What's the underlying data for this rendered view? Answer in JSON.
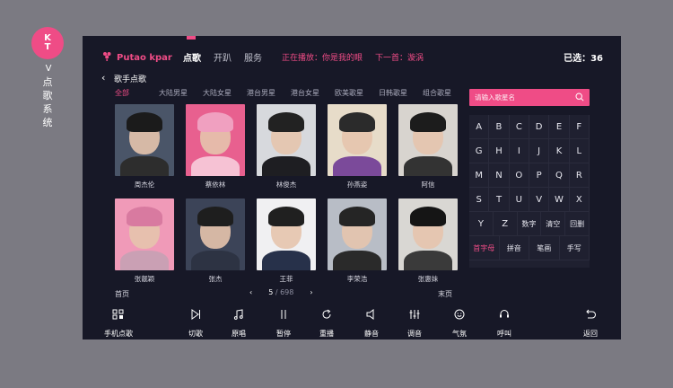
{
  "side": {
    "badge_k": "K",
    "badge_t": "T",
    "v": "V",
    "chars": [
      "点",
      "歌",
      "系",
      "统"
    ]
  },
  "header": {
    "logo_text": "Putao kpar",
    "nav": [
      "点歌",
      "开趴",
      "服务"
    ],
    "now_playing": "正在播放：你是我的眼",
    "next_up": "下一首：漩涡",
    "selected": "已选：36"
  },
  "page": {
    "title": "歌手点歌"
  },
  "categories": [
    "全部",
    "大陆男星",
    "大陆女星",
    "港台男星",
    "港台女星",
    "欧美歌星",
    "日韩歌星",
    "组合歌星"
  ],
  "singers": [
    {
      "name": "周杰伦",
      "bg": "#4a5568",
      "hair": "#1b1b1b",
      "body": "#2d2d2d"
    },
    {
      "name": "蔡依林",
      "bg": "#e8608f",
      "hair": "#f0a0c0",
      "body": "#f6c2d4"
    },
    {
      "name": "林俊杰",
      "bg": "#d7d9dd",
      "hair": "#222",
      "body": "#1e1e22"
    },
    {
      "name": "孙燕姿",
      "bg": "#e7dcc9",
      "hair": "#2b2b2b",
      "body": "#7b4a9a"
    },
    {
      "name": "阿信",
      "bg": "#d8d4cf",
      "hair": "#1c1c1c",
      "body": "#333"
    },
    {
      "name": "张靓颖",
      "bg": "#f09ab8",
      "hair": "#d87aa0",
      "body": "#caa0b4"
    },
    {
      "name": "张杰",
      "bg": "#3c4458",
      "hair": "#1e1e1e",
      "body": "#2d3343"
    },
    {
      "name": "王菲",
      "bg": "#f0f0f2",
      "hair": "#202020",
      "body": "#27314a"
    },
    {
      "name": "李荣浩",
      "bg": "#b8bdc6",
      "hair": "#252525",
      "body": "#2a2a2a"
    },
    {
      "name": "张惠妹",
      "bg": "#d9d7d3",
      "hair": "#151515",
      "body": "#3a3a3a"
    }
  ],
  "pagination": {
    "first": "首页",
    "last": "末页",
    "current": "5",
    "total": "/ 698"
  },
  "search": {
    "placeholder": "请输入歌星名"
  },
  "keyboard": [
    [
      "A",
      "B",
      "C",
      "D",
      "E",
      "F"
    ],
    [
      "G",
      "H",
      "I",
      "J",
      "K",
      "L"
    ],
    [
      "M",
      "N",
      "O",
      "P",
      "Q",
      "R"
    ],
    [
      "S",
      "T",
      "U",
      "V",
      "W",
      "X"
    ],
    [
      "Y",
      "Z",
      "数字",
      "清空",
      "回删"
    ],
    [
      "首字母",
      "拼音",
      "笔画",
      "手写"
    ]
  ],
  "toolbar": [
    {
      "label": "手机点歌",
      "icon": "phone-order-icon"
    },
    {
      "label": "切歌",
      "icon": "skip-icon"
    },
    {
      "label": "原唱",
      "icon": "original-vocal-icon"
    },
    {
      "label": "暂停",
      "icon": "pause-icon"
    },
    {
      "label": "重播",
      "icon": "replay-icon"
    },
    {
      "label": "静音",
      "icon": "mute-icon"
    },
    {
      "label": "调音",
      "icon": "tune-icon"
    },
    {
      "label": "气氛",
      "icon": "atmosphere-icon"
    },
    {
      "label": "呼叫",
      "icon": "call-service-icon"
    },
    {
      "label": "返回",
      "icon": "return-icon"
    }
  ],
  "colors": {
    "accent": "#ef4c86",
    "screen_bg": "#171827",
    "page_bg": "#7b7a82"
  }
}
